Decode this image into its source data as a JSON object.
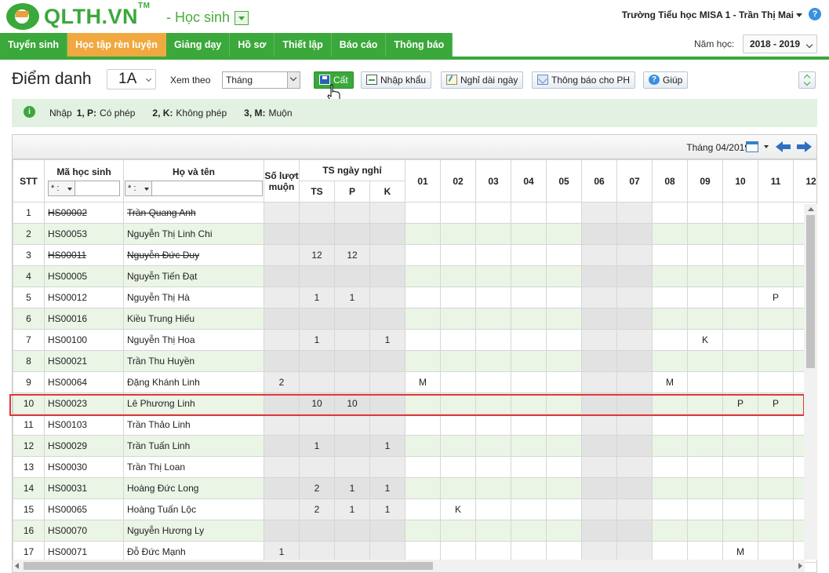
{
  "header": {
    "logo_text": "QLTH.VN",
    "logo_tm": "TM",
    "module": "- Học sinh",
    "user": "Trường Tiểu học MISA 1 - Trần Thị Mai",
    "help": "?"
  },
  "nav": {
    "items": [
      "Tuyển sinh",
      "Học tập rèn luyện",
      "Giảng dạy",
      "Hồ sơ",
      "Thiết lập",
      "Báo cáo",
      "Thông báo"
    ],
    "active_index": 1,
    "year_label": "Năm học:",
    "year_value": "2018 - 2019"
  },
  "toolbar": {
    "title": "Điểm danh",
    "class_value": "1A",
    "view_label": "Xem theo",
    "view_value": "Tháng",
    "save_label": "Cất",
    "import_label": "Nhập khẩu",
    "long_leave_label": "Nghỉ dài ngày",
    "notify_label": "Thông báo cho PH",
    "help_label": "Giúp"
  },
  "legend": {
    "icon": "i",
    "intro": "Nhập",
    "items": [
      {
        "key": "1, P:",
        "text": "Có phép"
      },
      {
        "key": "2, K:",
        "text": "Không phép"
      },
      {
        "key": "3, M:",
        "text": "Muộn"
      }
    ]
  },
  "grid": {
    "month_label": "Tháng 04/2019",
    "headers": {
      "stt": "STT",
      "code": "Mã học sinh",
      "name": "Họ và tên",
      "late": "Số lượt muộn",
      "absence_group": "TS ngày nghỉ",
      "ts": "TS",
      "p": "P",
      "k": "K",
      "filter_op": "* :"
    },
    "days": [
      "01",
      "02",
      "03",
      "04",
      "05",
      "06",
      "07",
      "08",
      "09",
      "10",
      "11",
      "12"
    ],
    "gray_days": [
      "06",
      "07"
    ],
    "rows": [
      {
        "stt": "1",
        "code": "HS00002",
        "name": "Trần Quang Anh",
        "late": "",
        "ts": "",
        "p": "",
        "k": "",
        "marks": {},
        "deleted": true
      },
      {
        "stt": "2",
        "code": "HS00053",
        "name": "Nguyễn Thị Linh Chi",
        "late": "",
        "ts": "",
        "p": "",
        "k": "",
        "marks": {}
      },
      {
        "stt": "3",
        "code": "HS00011",
        "name": "Nguyễn Đức Duy",
        "late": "",
        "ts": "12",
        "p": "12",
        "k": "",
        "marks": {},
        "deleted": true
      },
      {
        "stt": "4",
        "code": "HS00005",
        "name": "Nguyễn Tiến Đạt",
        "late": "",
        "ts": "",
        "p": "",
        "k": "",
        "marks": {}
      },
      {
        "stt": "5",
        "code": "HS00012",
        "name": "Nguyễn Thị Hà",
        "late": "",
        "ts": "1",
        "p": "1",
        "k": "",
        "marks": {
          "11": "P"
        }
      },
      {
        "stt": "6",
        "code": "HS00016",
        "name": "Kiều Trung Hiếu",
        "late": "",
        "ts": "",
        "p": "",
        "k": "",
        "marks": {}
      },
      {
        "stt": "7",
        "code": "HS00100",
        "name": "Nguyễn Thị Hoa",
        "late": "",
        "ts": "1",
        "p": "",
        "k": "1",
        "marks": {
          "09": "K"
        }
      },
      {
        "stt": "8",
        "code": "HS00021",
        "name": "Trần Thu Huyền",
        "late": "",
        "ts": "",
        "p": "",
        "k": "",
        "marks": {}
      },
      {
        "stt": "9",
        "code": "HS00064",
        "name": "Đặng Khánh Linh",
        "late": "2",
        "ts": "",
        "p": "",
        "k": "",
        "marks": {
          "01": "M",
          "08": "M"
        }
      },
      {
        "stt": "10",
        "code": "HS00023",
        "name": "Lê Phương Linh",
        "late": "",
        "ts": "10",
        "p": "10",
        "k": "",
        "marks": {
          "10": "P",
          "11": "P"
        }
      },
      {
        "stt": "11",
        "code": "HS00103",
        "name": "Trần Thảo Linh",
        "late": "",
        "ts": "",
        "p": "",
        "k": "",
        "marks": {}
      },
      {
        "stt": "12",
        "code": "HS00029",
        "name": "Trần Tuấn Linh",
        "late": "",
        "ts": "1",
        "p": "",
        "k": "1",
        "marks": {}
      },
      {
        "stt": "13",
        "code": "HS00030",
        "name": "Trần Thị Loan",
        "late": "",
        "ts": "",
        "p": "",
        "k": "",
        "marks": {}
      },
      {
        "stt": "14",
        "code": "HS00031",
        "name": "Hoàng Đức Long",
        "late": "",
        "ts": "2",
        "p": "1",
        "k": "1",
        "marks": {}
      },
      {
        "stt": "15",
        "code": "HS00065",
        "name": "Hoàng Tuấn Lộc",
        "late": "",
        "ts": "2",
        "p": "1",
        "k": "1",
        "marks": {
          "02": "K"
        }
      },
      {
        "stt": "16",
        "code": "HS00070",
        "name": "Nguyễn Hương Ly",
        "late": "",
        "ts": "",
        "p": "",
        "k": "",
        "marks": {}
      },
      {
        "stt": "17",
        "code": "HS00071",
        "name": "Đỗ Đức Mạnh",
        "late": "1",
        "ts": "",
        "p": "",
        "k": "",
        "marks": {
          "10": "M"
        }
      }
    ]
  },
  "colors": {
    "brand_green": "#3aa83a",
    "active_tab": "#f0a940",
    "highlight_border": "#e0383b",
    "row_alt": "#eaf5e6"
  }
}
